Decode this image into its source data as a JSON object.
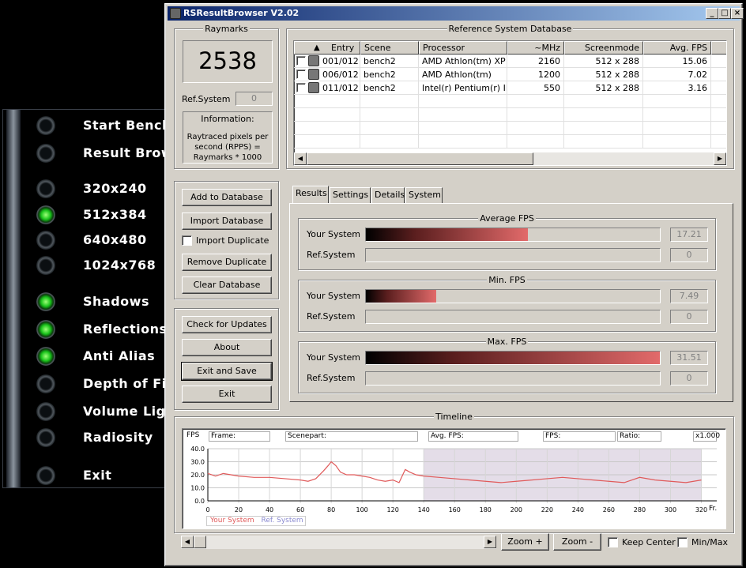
{
  "launcher": {
    "items": [
      {
        "label": "Start Bench",
        "on": false
      },
      {
        "label": "Result Brow",
        "on": false
      },
      {
        "label": "320x240",
        "on": false
      },
      {
        "label": "512x384",
        "on": true
      },
      {
        "label": "640x480",
        "on": false
      },
      {
        "label": "1024x768",
        "on": false
      },
      {
        "label": "Shadows",
        "on": true
      },
      {
        "label": "Reflections",
        "on": true
      },
      {
        "label": "Anti Alias",
        "on": true
      },
      {
        "label": "Depth of Fi",
        "on": false
      },
      {
        "label": "Volume Lig",
        "on": false
      },
      {
        "label": "Radiosity",
        "on": false
      },
      {
        "label": "Exit",
        "on": false
      }
    ]
  },
  "window": {
    "title": "RSResultBrowser V2.02",
    "min": "_",
    "max": "□",
    "close": "×"
  },
  "raymarks": {
    "group_title": "Raymarks",
    "score": "2538",
    "ref_label": "Ref.System",
    "ref_value": "0",
    "info_title": "Information:",
    "info_text": "Raytraced pixels per second (RPPS) = Raymarks * 1000"
  },
  "db_buttons": {
    "add": "Add to Database",
    "import": "Import Database",
    "import_dup": "Import Duplicate",
    "remove_dup": "Remove Duplicate",
    "clear": "Clear Database"
  },
  "app_buttons": {
    "updates": "Check for Updates",
    "about": "About",
    "exit_save": "Exit and Save",
    "exit": "Exit"
  },
  "refdb": {
    "title": "Reference System Database",
    "sort_indicator": "▲",
    "headers": [
      "Entry",
      "Scene",
      "Processor",
      "~MHz",
      "Screenmode",
      "Avg. FPS"
    ],
    "rows": [
      [
        "001/012",
        "bench2",
        "AMD Athlon(tm) XP",
        "2160",
        "512 x   288",
        "15.06"
      ],
      [
        "006/012",
        "bench2",
        "AMD Athlon(tm)",
        "1200",
        "512 x   288",
        "7.02"
      ],
      [
        "011/012",
        "bench2",
        "Intel(r) Pentium(r) III",
        "550",
        "512 x   288",
        "3.16"
      ]
    ]
  },
  "tabs": [
    "Results",
    "Settings",
    "Details",
    "System"
  ],
  "results": {
    "your_label": "Your System",
    "ref_label": "Ref.System",
    "sections": [
      {
        "title": "Average FPS",
        "your_value": "17.21",
        "ref_value": "0",
        "fill": 0.55
      },
      {
        "title": "Min. FPS",
        "your_value": "7.49",
        "ref_value": "0",
        "fill": 0.24
      },
      {
        "title": "Max. FPS",
        "your_value": "31.51",
        "ref_value": "0",
        "fill": 1.0
      }
    ]
  },
  "timeline": {
    "title": "Timeline",
    "fps_label": "FPS",
    "fields": {
      "frame": "Frame:",
      "scenepart": "Scenepart:",
      "avg": "Avg. FPS:",
      "fps": "FPS:",
      "ratio": "Ratio:",
      "zoom": "x1.000"
    },
    "legend_your": "Your System",
    "legend_ref": "Ref. System",
    "fr_label": "Fr.",
    "zoom_in": "Zoom +",
    "zoom_out": "Zoom -",
    "keep_center": "Keep Center",
    "minmax": "Min/Max",
    "colors": {
      "your": "#e05a5a",
      "ref": "#8a8ad0",
      "band": "#e4dde8"
    }
  },
  "chart_data": {
    "type": "line",
    "xlabel": "Fr.",
    "ylabel": "FPS",
    "xlim": [
      0,
      330
    ],
    "ylim": [
      0,
      40
    ],
    "xticks": [
      0,
      20,
      40,
      60,
      80,
      100,
      120,
      140,
      160,
      180,
      200,
      220,
      240,
      260,
      280,
      300,
      320
    ],
    "yticks": [
      "0.0",
      "10.0",
      "20.0",
      "30.0",
      "40.0"
    ],
    "series": [
      {
        "name": "Your System",
        "x": [
          0,
          5,
          10,
          20,
          30,
          40,
          50,
          60,
          65,
          70,
          75,
          78,
          80,
          83,
          86,
          90,
          95,
          100,
          105,
          110,
          115,
          120,
          124,
          126,
          128,
          131,
          135,
          140,
          150,
          160,
          170,
          180,
          190,
          200,
          210,
          220,
          230,
          240,
          250,
          260,
          270,
          280,
          290,
          300,
          310,
          320
        ],
        "y": [
          21,
          19,
          21,
          19,
          18,
          18,
          17,
          16,
          15,
          17,
          23,
          27,
          30,
          27,
          22,
          20,
          20,
          19,
          18,
          16,
          15,
          16,
          14,
          19,
          24,
          22,
          20,
          19,
          18,
          17,
          16,
          15,
          14,
          15,
          16,
          17,
          18,
          17,
          16,
          15,
          14,
          18,
          16,
          15,
          14,
          16
        ]
      }
    ]
  }
}
